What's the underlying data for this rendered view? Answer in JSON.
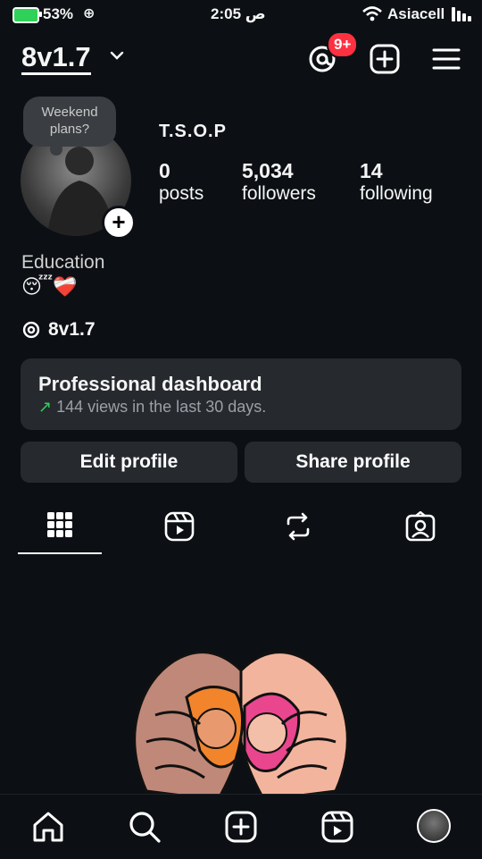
{
  "status_bar": {
    "battery_pct": "53%",
    "time": "2:05 ص",
    "carrier": "Asiacell"
  },
  "header": {
    "username": "8v1.7",
    "notif_badge": "9+"
  },
  "profile": {
    "note": "Weekend plans?",
    "full_name": "T.S.O.P",
    "stats": [
      {
        "value": "0",
        "label": "posts"
      },
      {
        "value": "5,034",
        "label": "followers"
      },
      {
        "value": "14",
        "label": "following"
      }
    ],
    "bio_line1": "Education",
    "bio_line2": "😴❤️‍🩹",
    "threads_handle": "8v1.7"
  },
  "dashboard": {
    "title": "Professional dashboard",
    "arrow": "↗",
    "subtitle": "144 views in the last 30 days."
  },
  "buttons": {
    "edit": "Edit profile",
    "share": "Share profile"
  },
  "tabs": [
    {
      "name": "grid",
      "active": true
    },
    {
      "name": "reels",
      "active": false
    },
    {
      "name": "reposts",
      "active": false
    },
    {
      "name": "tagged",
      "active": false
    }
  ],
  "colors": {
    "background": "#0c1014",
    "surface": "#262a2f",
    "badge_red": "#ff3040",
    "trend_green": "#2fd158"
  }
}
